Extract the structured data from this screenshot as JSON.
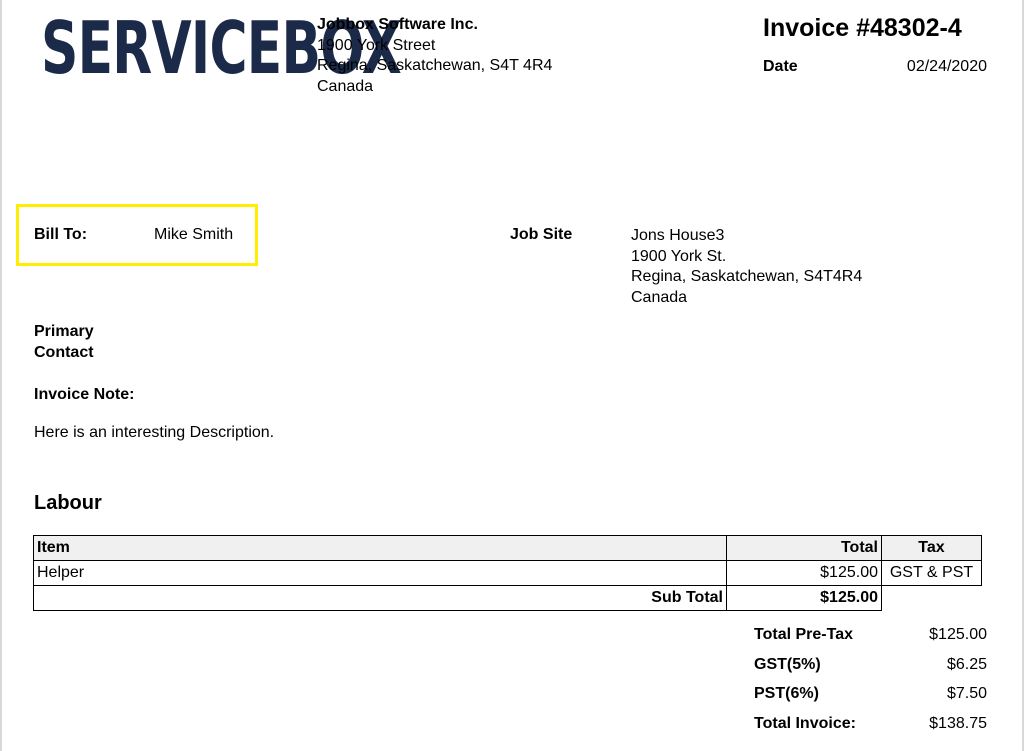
{
  "logo": {
    "text": "SERVICEBOX",
    "color": "#1c2a4a"
  },
  "company": {
    "name": "Jobbox Software Inc.",
    "address_lines": [
      "1900 York Street",
      "Regina, Saskatchewan, S4T 4R4",
      "Canada"
    ]
  },
  "invoice": {
    "title": "Invoice #48302-4",
    "date_label": "Date",
    "date": "02/24/2020"
  },
  "bill_to": {
    "label": "Bill To:",
    "name": "Mike Smith",
    "highlight_color": "#ffee00"
  },
  "job_site": {
    "label": "Job Site",
    "address_lines": [
      "Jons House3",
      "1900 York St.",
      "Regina, Saskatchewan, S4T4R4",
      "Canada"
    ]
  },
  "primary_contact": {
    "label_line1": "Primary",
    "label_line2": "Contact"
  },
  "invoice_note": {
    "label": "Invoice Note:",
    "text": "Here is an interesting Description."
  },
  "labour": {
    "title": "Labour",
    "columns": {
      "item": "Item",
      "total": "Total",
      "tax": "Tax"
    },
    "rows": [
      {
        "item": "Helper",
        "total": "$125.00",
        "tax": "GST & PST"
      }
    ],
    "subtotal_label": "Sub Total",
    "subtotal_value": "$125.00"
  },
  "totals": [
    {
      "label": "Total Pre-Tax",
      "value": "$125.00"
    },
    {
      "label": "GST(5%)",
      "value": "$6.25"
    },
    {
      "label": "PST(6%)",
      "value": "$7.50"
    },
    {
      "label": "Total Invoice:",
      "value": "$138.75"
    }
  ]
}
